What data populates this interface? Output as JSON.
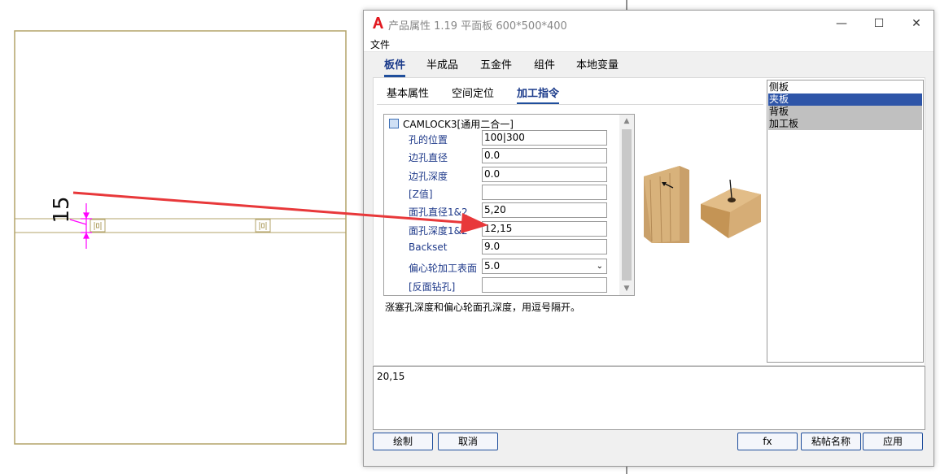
{
  "cad": {
    "dimension_text": "15",
    "border_color": "#b3a368",
    "dim_color": "#ff00ff"
  },
  "window": {
    "title": "产品属性 1.19 平面板 600*500*400",
    "app_icon": "autocad-a-icon",
    "controls": {
      "minimize": "—",
      "maximize": "☐",
      "close": "✕"
    }
  },
  "menu": {
    "file": "文件"
  },
  "main_tabs": [
    {
      "label": "板件",
      "active": true
    },
    {
      "label": "半成品",
      "active": false
    },
    {
      "label": "五金件",
      "active": false
    },
    {
      "label": "组件",
      "active": false
    },
    {
      "label": "本地变量",
      "active": false
    }
  ],
  "sub_tabs": [
    {
      "label": "基本属性",
      "active": false
    },
    {
      "label": "空间定位",
      "active": false
    },
    {
      "label": "加工指令",
      "active": true
    }
  ],
  "property_grid": {
    "group_title": "CAMLOCK3[通用二合一]",
    "rows": [
      {
        "label": "孔的位置",
        "value": "100|300"
      },
      {
        "label": "边孔直径",
        "value": "0.0"
      },
      {
        "label": "边孔深度",
        "value": "0.0"
      },
      {
        "label": "[Z值]",
        "value": ""
      },
      {
        "label": "面孔直径1&2",
        "value": "5,20"
      },
      {
        "label": "面孔深度1&2",
        "value": "12,15"
      },
      {
        "label": "Backset",
        "value": "9.0"
      },
      {
        "label": "偏心轮加工表面",
        "value": "5.0",
        "dropdown": true
      },
      {
        "label": "[反面钻孔]",
        "value": ""
      }
    ]
  },
  "hint_text": "涨塞孔深度和偏心轮面孔深度，用逗号隔开。",
  "list_items": [
    {
      "label": "侧板",
      "selected": false,
      "plain": true
    },
    {
      "label": "夹板",
      "selected": true
    },
    {
      "label": "背板",
      "selected": false
    },
    {
      "label": "加工板",
      "selected": false
    }
  ],
  "value_text": "20,15",
  "buttons": {
    "draw": "绘制",
    "cancel": "取消",
    "fx": "fx",
    "paste_name": "粘帖名称",
    "apply": "应用"
  },
  "colors": {
    "accent": "#1f4e9c",
    "selection": "#2e55a8",
    "arrow": "#e8383a"
  }
}
